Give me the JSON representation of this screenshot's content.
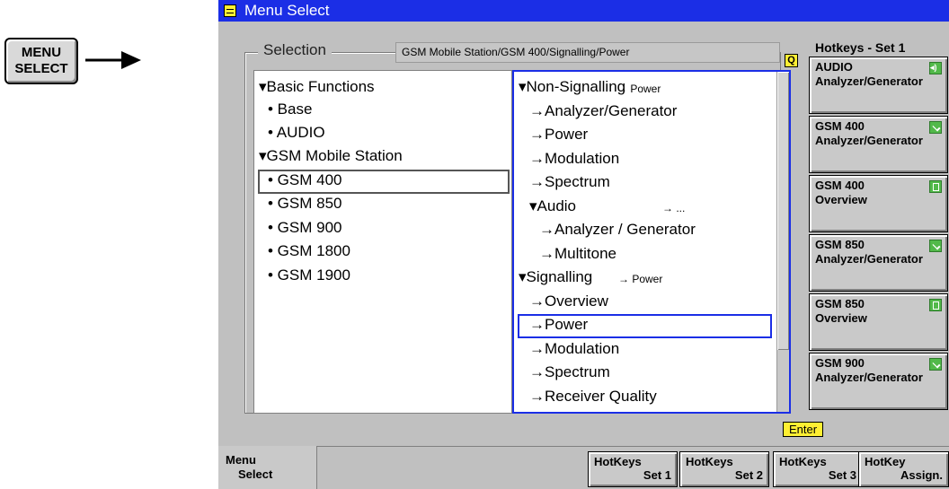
{
  "hardkey": {
    "line1": "MENU",
    "line2": "SELECT"
  },
  "window": {
    "title": "Menu Select"
  },
  "selection": {
    "label": "Selection",
    "path": "GSM Mobile Station/GSM 400/Signalling/Power",
    "q_icon": "Q"
  },
  "left_tree": [
    "▾Basic Functions",
    "• Base",
    "• AUDIO",
    "▾GSM Mobile Station",
    "• GSM 400",
    "• GSM 850",
    "• GSM 900",
    "• GSM 1800",
    "• GSM 1900"
  ],
  "right_tree": [
    {
      "text": "▾Non-Signalling",
      "sub": "→ Power"
    },
    {
      "text": "→Analyzer/Generator",
      "sub": ""
    },
    {
      "text": "→Power",
      "sub": ""
    },
    {
      "text": "→Modulation",
      "sub": ""
    },
    {
      "text": "→Spectrum",
      "sub": ""
    },
    {
      "text": "▾Audio",
      "sub": "→ ..."
    },
    {
      "text": "→Analyzer / Generator",
      "sub": ""
    },
    {
      "text": "→Multitone",
      "sub": ""
    },
    {
      "text": "▾Signalling",
      "sub": "→ Power"
    },
    {
      "text": "→Overview",
      "sub": ""
    },
    {
      "text": "→Power",
      "sub": ""
    },
    {
      "text": "→Modulation",
      "sub": ""
    },
    {
      "text": "→Spectrum",
      "sub": ""
    },
    {
      "text": "→Receiver Quality",
      "sub": ""
    }
  ],
  "enter_label": "Enter",
  "hotkeys": {
    "title": "Hotkeys - Set 1",
    "items": [
      {
        "line1": "AUDIO",
        "line2": "Analyzer/Generator",
        "icon": "audio-icon"
      },
      {
        "line1": "GSM 400",
        "line2": "Analyzer/Generator",
        "icon": "generator-icon"
      },
      {
        "line1": "GSM 400",
        "line2": "Overview",
        "icon": "overview-icon"
      },
      {
        "line1": "GSM 850",
        "line2": "Analyzer/Generator",
        "icon": "generator-icon"
      },
      {
        "line1": "GSM 850",
        "line2": "Overview",
        "icon": "overview-icon"
      },
      {
        "line1": "GSM 900",
        "line2": "Analyzer/Generator",
        "icon": "generator-icon"
      }
    ]
  },
  "softkeys": {
    "menu_select": {
      "line1": "Menu",
      "line2": "Select"
    },
    "items": [
      {
        "line1": "HotKeys",
        "line2": "Set 1"
      },
      {
        "line1": "HotKeys",
        "line2": "Set 2"
      },
      {
        "line1": "HotKeys",
        "line2": "Set 3"
      },
      {
        "line1": "HotKey",
        "line2": "Assign."
      }
    ]
  },
  "colors": {
    "accent": "#1b2ee6",
    "highlight": "#ffef33",
    "panel": "#c0c0c0"
  }
}
